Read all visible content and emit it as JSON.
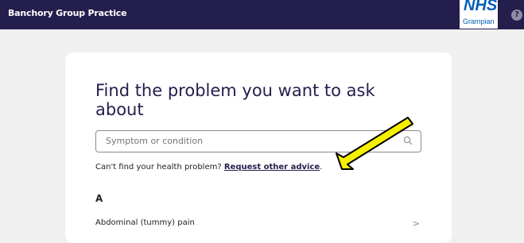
{
  "header": {
    "practice_name": "Banchory Group Practice",
    "logo_mark": "NHS",
    "logo_region": "Grampian",
    "help_label": "?"
  },
  "main": {
    "title": "Find the problem you want to ask about",
    "search": {
      "placeholder": "Symptom or condition",
      "value": ""
    },
    "help_text": "Can't find your health problem?",
    "help_link": "Request other advice",
    "help_punct": ".",
    "section_letter": "A",
    "items": [
      {
        "label": "Abdominal (tummy) pain",
        "chevron": ">"
      }
    ]
  },
  "annotation": {
    "arrow_color": "#f5f000",
    "icon": "arrow-pointer"
  },
  "colors": {
    "navy": "#231e4c",
    "nhs_blue": "#005eb8",
    "page_bg": "#f0f0f0"
  }
}
